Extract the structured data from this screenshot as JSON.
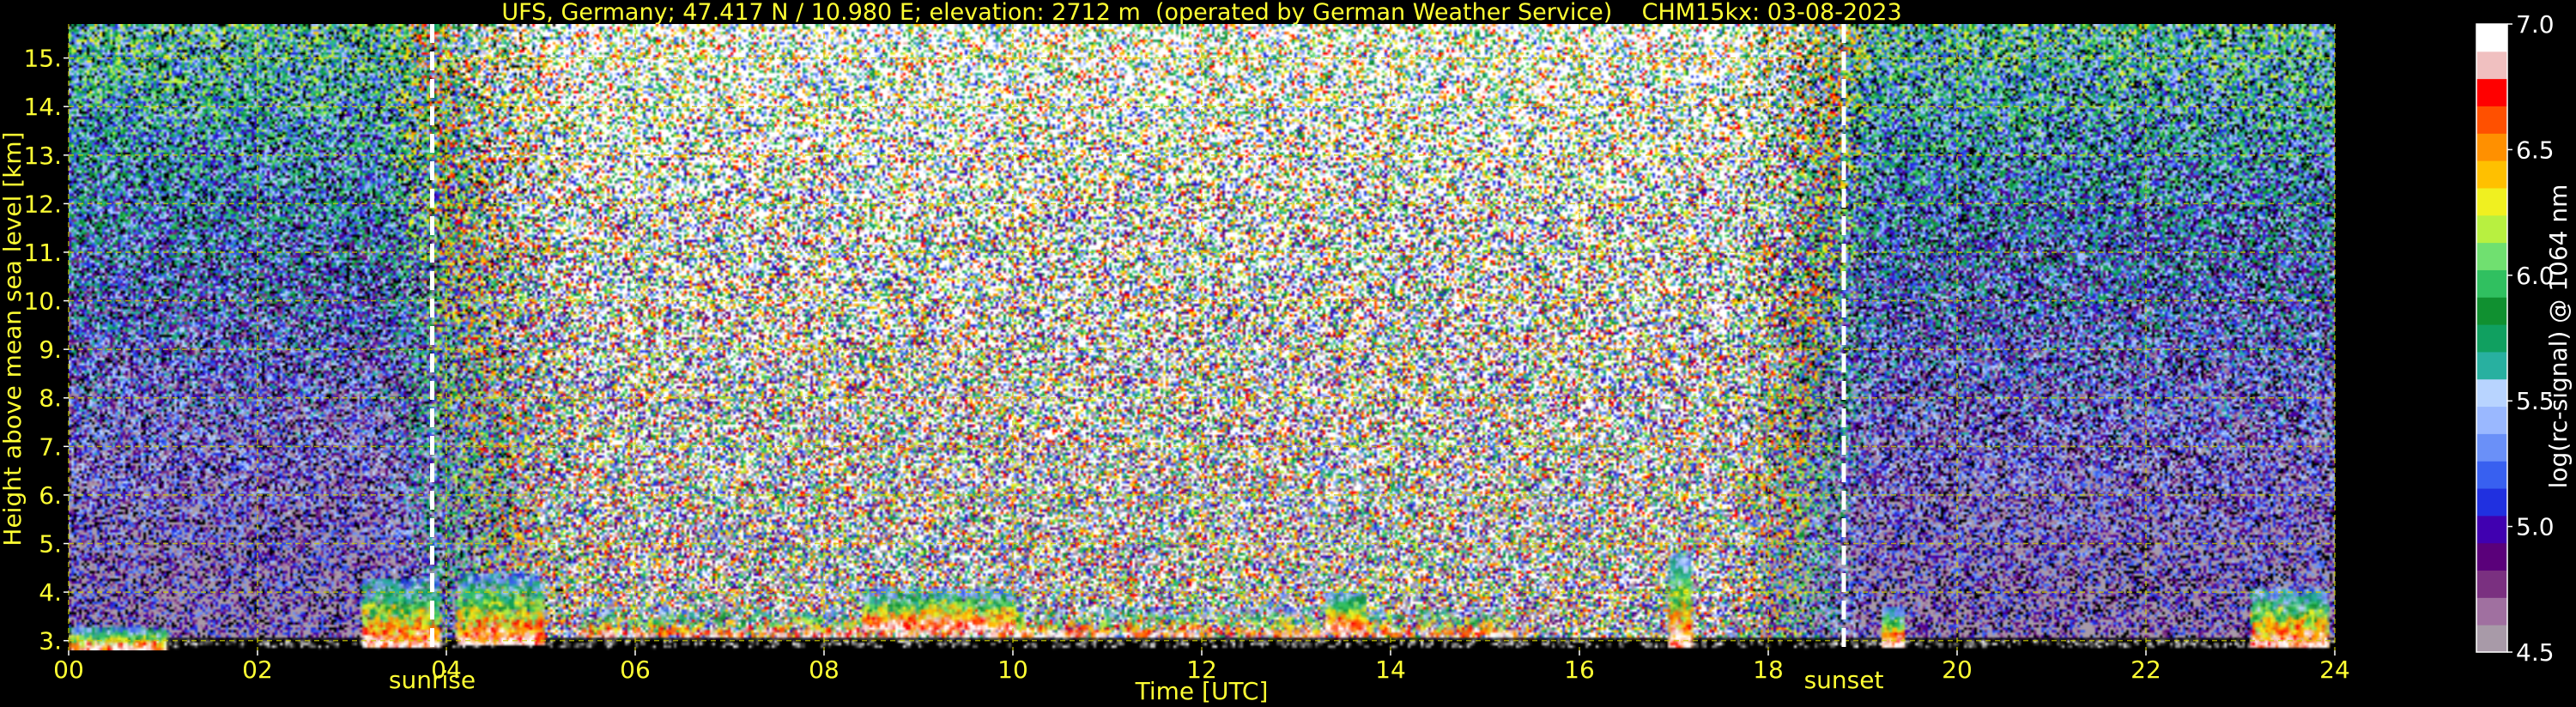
{
  "chart_data": {
    "type": "heatmap",
    "title": "UFS, Germany; 47.417 N / 10.980 E; elevation: 2712 m  (operated by German Weather Service)    CHM15kx: 03-08-2023",
    "xlabel": "Time [UTC]",
    "ylabel": "Height above mean sea level [km]",
    "xlim": [
      0,
      24
    ],
    "ylim": [
      2.8,
      15.7
    ],
    "x_ticks": [
      "00",
      "02",
      "04",
      "06",
      "08",
      "10",
      "12",
      "14",
      "16",
      "18",
      "20",
      "22",
      "24"
    ],
    "y_ticks": [
      "3.",
      "4.",
      "5.",
      "6.",
      "7.",
      "8.",
      "9.",
      "10.",
      "11.",
      "12.",
      "13.",
      "14.",
      "15."
    ],
    "grid": true,
    "colorbar": {
      "label": "log(rc-signal) @ 1064 nm",
      "range": [
        4.5,
        7.0
      ],
      "ticks": [
        "4.5",
        "5.0",
        "5.5",
        "6.0",
        "6.5",
        "7.0"
      ]
    },
    "markers": [
      {
        "label": "sunrise",
        "x": 3.85
      },
      {
        "label": "sunset",
        "x": 18.8
      }
    ],
    "colors": {
      "axis_text": "#ffff33",
      "grid": "#cccc00",
      "marker_line": "#ffffff",
      "colorbar_text": "#ffffff"
    },
    "colorbar_stops": [
      "#a89aa8",
      "#a070a0",
      "#7a3080",
      "#5a007a",
      "#4000b0",
      "#2030e0",
      "#3860f0",
      "#6a90f8",
      "#9ab8ff",
      "#b8d4ff",
      "#28b0a0",
      "#10a060",
      "#109030",
      "#30c060",
      "#70e070",
      "#b8f040",
      "#f0f020",
      "#ffc000",
      "#ff9000",
      "#ff5000",
      "#ff0000",
      "#f0c0c0",
      "#ffffff"
    ],
    "features": {
      "day_noise_hours": [
        5.5,
        17.5
      ],
      "cloud_blocks": [
        {
          "t0": 3.1,
          "t1": 3.9,
          "h0": 2.95,
          "h1": 4.3
        },
        {
          "t0": 4.1,
          "t1": 5.0,
          "h0": 3.0,
          "h1": 4.4
        },
        {
          "t0": 5.4,
          "t1": 15.3,
          "h0": 3.15,
          "h1": 3.7
        },
        {
          "t0": 8.4,
          "t1": 10.0,
          "h0": 3.3,
          "h1": 4.1
        },
        {
          "t0": 13.3,
          "t1": 13.7,
          "h0": 3.3,
          "h1": 4.0
        },
        {
          "t0": 16.95,
          "t1": 17.15,
          "h0": 2.95,
          "h1": 4.8
        },
        {
          "t0": 19.2,
          "t1": 19.4,
          "h0": 2.95,
          "h1": 3.7
        },
        {
          "t0": 23.1,
          "t1": 23.9,
          "h0": 2.95,
          "h1": 4.1
        },
        {
          "t0": 0.0,
          "t1": 1.0,
          "h0": 2.85,
          "h1": 3.3
        }
      ]
    }
  }
}
